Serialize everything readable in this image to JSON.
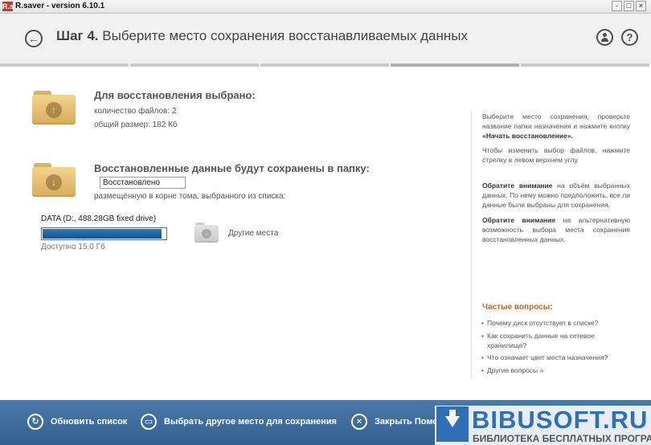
{
  "window": {
    "title": "R.saver - version 6.10.1",
    "app_icon": "R.s",
    "buttons": [
      "-",
      "□",
      "×"
    ]
  },
  "header": {
    "step_label": "Шаг 4.",
    "step_title": "Выберите место сохранения восстанавливаемых данных"
  },
  "summary": {
    "heading": "Для восстановления выбрано:",
    "file_count": "количество файлов: 2",
    "total_size": "общий размер: 182 Кб"
  },
  "destination": {
    "heading": "Восстановленные данные будут сохранены в папку:",
    "folder_name": "Восстановлено",
    "note": "размещённую в корне тома, выбранного из списка:",
    "drive_label": "DATA (D:, 488.28GB fixed drive)",
    "drive_used_fraction": 0.97,
    "free_space": "Доступно 15.0 Гб",
    "other_places": "Другие места"
  },
  "sidebar": {
    "intro": "Выберите место сохранения, проверьте название папки назначения и нажмите кнопку",
    "intro_button": "«Начать восстановление».",
    "change_hint": "Чтобы изменить выбор файлов, нажмите стрелку в левом верхнем углу.",
    "attention_label": "Обратите внимание",
    "attention1": "на объём выбранных данных. По нему можно предположить, все ли данные были выбраны для сохранения.",
    "attention2": "на альтернативную возможность выбора места сохранения восстановленных данных.",
    "faq_title": "Частые вопросы:",
    "faq": [
      "Почему диск отсутствует в списке?",
      "Как сохранить данные на сетевое хранилище?",
      "Что означает цвет места назначения?",
      "Другие вопросы »"
    ]
  },
  "footer": {
    "refresh": "Обновить список",
    "choose_other": "Выбрать другое место для сохранения",
    "close": "Закрыть Помо"
  },
  "watermark": {
    "name": "BIBUSOFT.RU",
    "tagline": "БИБЛИОТЕКА БЕСПЛАТНЫХ ПРОГРАММ"
  },
  "colors": {
    "accent": "#33618f",
    "drive_fill": "#17548f",
    "folder": "#e8c070",
    "faq_title": "#b26a2a"
  }
}
